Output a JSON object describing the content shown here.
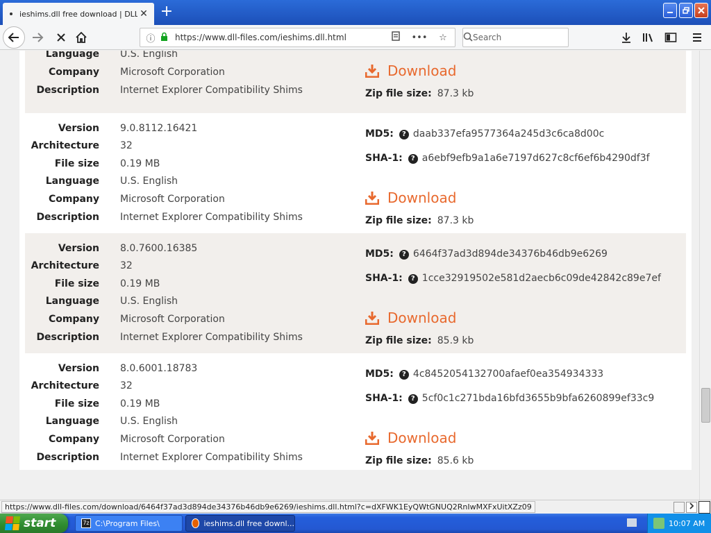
{
  "browser": {
    "tab_title": "ieshims.dll free download | DLL-file",
    "url": "https://www.dll-files.com/ieshims.dll.html",
    "search_placeholder": "Search",
    "new_tab_label": "+",
    "tab_close_label": "✕",
    "status_url": "https://www.dll-files.com/download/6464f37ad3d894de34376b46db9e6269/ieshims.dll.html?c=dXFWK1EyQWtGNUQ2RnIwMXFxUitXZz09"
  },
  "page": {
    "accent_color": "#e8692e",
    "labels": {
      "version": "Version",
      "architecture": "Architecture",
      "file_size": "File size",
      "language": "Language",
      "company": "Company",
      "description": "Description",
      "md5": "MD5:",
      "sha1": "SHA-1:",
      "download": "Download",
      "zip_file_size": "Zip file size:"
    },
    "entries": [
      {
        "version": "",
        "architecture": "",
        "file_size": "",
        "language": "U.S. English",
        "company": "Microsoft Corporation",
        "description": "Internet Explorer Compatibility Shims",
        "md5": "",
        "sha1": "",
        "zip_size": "87.3 kb"
      },
      {
        "version": "9.0.8112.16421",
        "architecture": "32",
        "file_size": "0.19 MB",
        "language": "U.S. English",
        "company": "Microsoft Corporation",
        "description": "Internet Explorer Compatibility Shims",
        "md5": "daab337efa9577364a245d3c6ca8d00c",
        "sha1": "a6ebf9efb9a1a6e7197d627c8cf6ef6b4290df3f",
        "zip_size": "87.3 kb"
      },
      {
        "version": "8.0.7600.16385",
        "architecture": "32",
        "file_size": "0.19 MB",
        "language": "U.S. English",
        "company": "Microsoft Corporation",
        "description": "Internet Explorer Compatibility Shims",
        "md5": "6464f37ad3d894de34376b46db9e6269",
        "sha1": "1cce32919502e581d2aecb6c09de42842c89e7ef",
        "zip_size": "85.9 kb"
      },
      {
        "version": "8.0.6001.18783",
        "architecture": "32",
        "file_size": "0.19 MB",
        "language": "U.S. English",
        "company": "Microsoft Corporation",
        "description": "Internet Explorer Compatibility Shims",
        "md5": "4c8452054132700afaef0ea354934333",
        "sha1": "5cf0c1c271bda16bfd3655b9bfa6260899ef33c9",
        "zip_size": "85.6 kb"
      }
    ]
  },
  "taskbar": {
    "start_label": "start",
    "task1_label": "C:\\Program Files\\",
    "task2_label": "ieshims.dll free downl...",
    "clock": "10:07 AM"
  }
}
